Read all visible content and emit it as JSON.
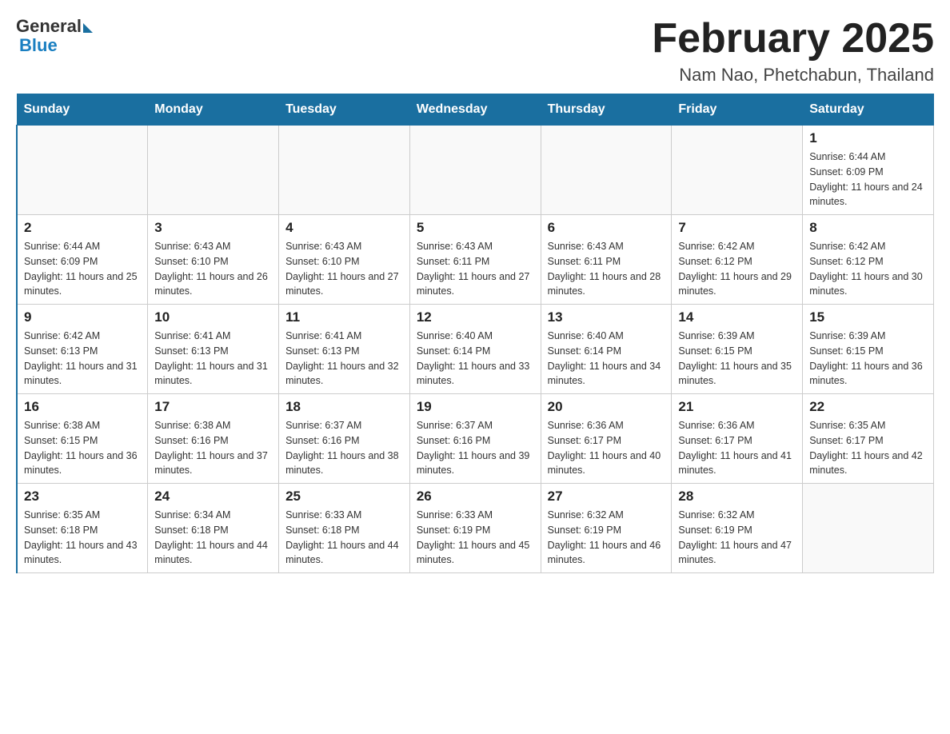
{
  "header": {
    "logo_general": "General",
    "logo_blue": "Blue",
    "month_title": "February 2025",
    "location": "Nam Nao, Phetchabun, Thailand"
  },
  "days_of_week": [
    "Sunday",
    "Monday",
    "Tuesday",
    "Wednesday",
    "Thursday",
    "Friday",
    "Saturday"
  ],
  "weeks": [
    [
      {
        "day": "",
        "info": ""
      },
      {
        "day": "",
        "info": ""
      },
      {
        "day": "",
        "info": ""
      },
      {
        "day": "",
        "info": ""
      },
      {
        "day": "",
        "info": ""
      },
      {
        "day": "",
        "info": ""
      },
      {
        "day": "1",
        "info": "Sunrise: 6:44 AM\nSunset: 6:09 PM\nDaylight: 11 hours and 24 minutes."
      }
    ],
    [
      {
        "day": "2",
        "info": "Sunrise: 6:44 AM\nSunset: 6:09 PM\nDaylight: 11 hours and 25 minutes."
      },
      {
        "day": "3",
        "info": "Sunrise: 6:43 AM\nSunset: 6:10 PM\nDaylight: 11 hours and 26 minutes."
      },
      {
        "day": "4",
        "info": "Sunrise: 6:43 AM\nSunset: 6:10 PM\nDaylight: 11 hours and 27 minutes."
      },
      {
        "day": "5",
        "info": "Sunrise: 6:43 AM\nSunset: 6:11 PM\nDaylight: 11 hours and 27 minutes."
      },
      {
        "day": "6",
        "info": "Sunrise: 6:43 AM\nSunset: 6:11 PM\nDaylight: 11 hours and 28 minutes."
      },
      {
        "day": "7",
        "info": "Sunrise: 6:42 AM\nSunset: 6:12 PM\nDaylight: 11 hours and 29 minutes."
      },
      {
        "day": "8",
        "info": "Sunrise: 6:42 AM\nSunset: 6:12 PM\nDaylight: 11 hours and 30 minutes."
      }
    ],
    [
      {
        "day": "9",
        "info": "Sunrise: 6:42 AM\nSunset: 6:13 PM\nDaylight: 11 hours and 31 minutes."
      },
      {
        "day": "10",
        "info": "Sunrise: 6:41 AM\nSunset: 6:13 PM\nDaylight: 11 hours and 31 minutes."
      },
      {
        "day": "11",
        "info": "Sunrise: 6:41 AM\nSunset: 6:13 PM\nDaylight: 11 hours and 32 minutes."
      },
      {
        "day": "12",
        "info": "Sunrise: 6:40 AM\nSunset: 6:14 PM\nDaylight: 11 hours and 33 minutes."
      },
      {
        "day": "13",
        "info": "Sunrise: 6:40 AM\nSunset: 6:14 PM\nDaylight: 11 hours and 34 minutes."
      },
      {
        "day": "14",
        "info": "Sunrise: 6:39 AM\nSunset: 6:15 PM\nDaylight: 11 hours and 35 minutes."
      },
      {
        "day": "15",
        "info": "Sunrise: 6:39 AM\nSunset: 6:15 PM\nDaylight: 11 hours and 36 minutes."
      }
    ],
    [
      {
        "day": "16",
        "info": "Sunrise: 6:38 AM\nSunset: 6:15 PM\nDaylight: 11 hours and 36 minutes."
      },
      {
        "day": "17",
        "info": "Sunrise: 6:38 AM\nSunset: 6:16 PM\nDaylight: 11 hours and 37 minutes."
      },
      {
        "day": "18",
        "info": "Sunrise: 6:37 AM\nSunset: 6:16 PM\nDaylight: 11 hours and 38 minutes."
      },
      {
        "day": "19",
        "info": "Sunrise: 6:37 AM\nSunset: 6:16 PM\nDaylight: 11 hours and 39 minutes."
      },
      {
        "day": "20",
        "info": "Sunrise: 6:36 AM\nSunset: 6:17 PM\nDaylight: 11 hours and 40 minutes."
      },
      {
        "day": "21",
        "info": "Sunrise: 6:36 AM\nSunset: 6:17 PM\nDaylight: 11 hours and 41 minutes."
      },
      {
        "day": "22",
        "info": "Sunrise: 6:35 AM\nSunset: 6:17 PM\nDaylight: 11 hours and 42 minutes."
      }
    ],
    [
      {
        "day": "23",
        "info": "Sunrise: 6:35 AM\nSunset: 6:18 PM\nDaylight: 11 hours and 43 minutes."
      },
      {
        "day": "24",
        "info": "Sunrise: 6:34 AM\nSunset: 6:18 PM\nDaylight: 11 hours and 44 minutes."
      },
      {
        "day": "25",
        "info": "Sunrise: 6:33 AM\nSunset: 6:18 PM\nDaylight: 11 hours and 44 minutes."
      },
      {
        "day": "26",
        "info": "Sunrise: 6:33 AM\nSunset: 6:19 PM\nDaylight: 11 hours and 45 minutes."
      },
      {
        "day": "27",
        "info": "Sunrise: 6:32 AM\nSunset: 6:19 PM\nDaylight: 11 hours and 46 minutes."
      },
      {
        "day": "28",
        "info": "Sunrise: 6:32 AM\nSunset: 6:19 PM\nDaylight: 11 hours and 47 minutes."
      },
      {
        "day": "",
        "info": ""
      }
    ]
  ]
}
